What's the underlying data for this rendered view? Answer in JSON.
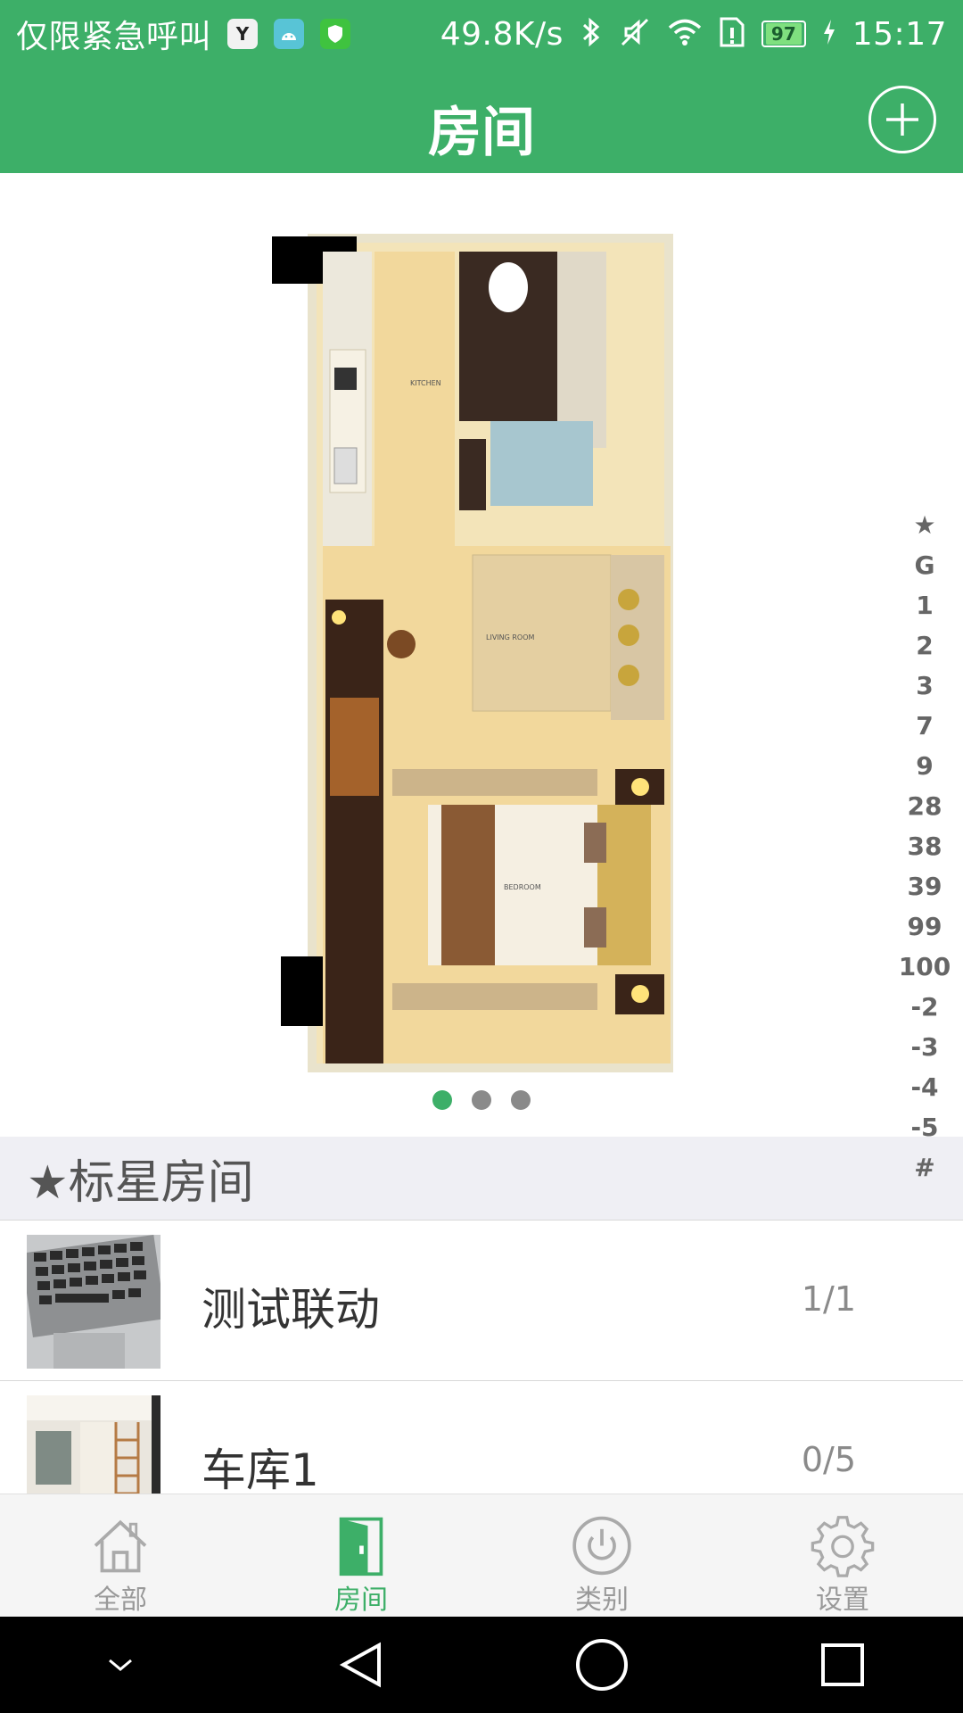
{
  "status_bar": {
    "carrier_text": "仅限紧急呼叫",
    "app_icons": [
      "y-app-icon",
      "android-icon",
      "shield-icon"
    ],
    "net_speed": "49.8K/s",
    "battery_level": "97",
    "time": "15:17"
  },
  "header": {
    "title": "房间",
    "add_icon": "plus-circle-icon"
  },
  "carousel": {
    "image": "floorplan",
    "page_count": 3,
    "active_index": 0
  },
  "index_bar": [
    "★",
    "G",
    "1",
    "2",
    "3",
    "7",
    "9",
    "28",
    "38",
    "39",
    "99",
    "100",
    "-2",
    "-3",
    "-4",
    "-5",
    "#"
  ],
  "section": {
    "title": "★标星房间"
  },
  "rooms": [
    {
      "name": "测试联动",
      "count": "1/1",
      "thumb": "laptop-keyboard"
    },
    {
      "name": "车库1",
      "count": "0/5",
      "thumb": "room-interior"
    }
  ],
  "bottom_nav": [
    {
      "label": "全部",
      "icon": "home-icon",
      "active": false
    },
    {
      "label": "房间",
      "icon": "door-icon",
      "active": true
    },
    {
      "label": "类别",
      "icon": "power-icon",
      "active": false
    },
    {
      "label": "设置",
      "icon": "gear-icon",
      "active": false
    }
  ],
  "colors": {
    "primary": "#3daf68",
    "section_bg": "#efeff4",
    "inactive": "#999999"
  }
}
